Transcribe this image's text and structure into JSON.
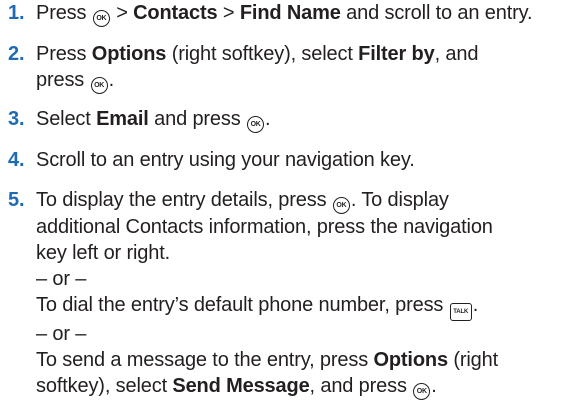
{
  "steps": [
    {
      "number": "1.",
      "t1": "Press ",
      "t2": " > ",
      "b1": "Contacts",
      "t3": " > ",
      "b2": "Find Name",
      "t4": " and scroll to an entry."
    },
    {
      "number": "2.",
      "t1": "Press ",
      "b1": "Options",
      "t2": " (right softkey), select ",
      "b2": "Filter by",
      "t3": ", and",
      "t4": "press ",
      "t5": "."
    },
    {
      "number": "3.",
      "t1": "Select ",
      "b1": "Email",
      "t2": " and press ",
      "t3": "."
    },
    {
      "number": "4.",
      "t1": "Scroll to an entry using your navigation key."
    },
    {
      "number": "5.",
      "l1a": "To display the entry details, press ",
      "l1b": ". To display",
      "l2": "additional Contacts information, press the navigation",
      "l3": "key left or right.",
      "or1": "– or –",
      "l4a": "To dial the entry’s default phone number, press ",
      "l4b": ".",
      "or2": "– or –",
      "l5a": "To send a message to the entry, press ",
      "l5b": "Options",
      "l5c": " (right",
      "l6a": "softkey), select ",
      "l6b": "Send Message",
      "l6c": ", and press ",
      "l6d": "."
    }
  ],
  "icons": {
    "ok_label": "OK",
    "talk_label": "TALK"
  },
  "colors": {
    "step_number": "#1e6ab3",
    "text": "#231f20"
  }
}
